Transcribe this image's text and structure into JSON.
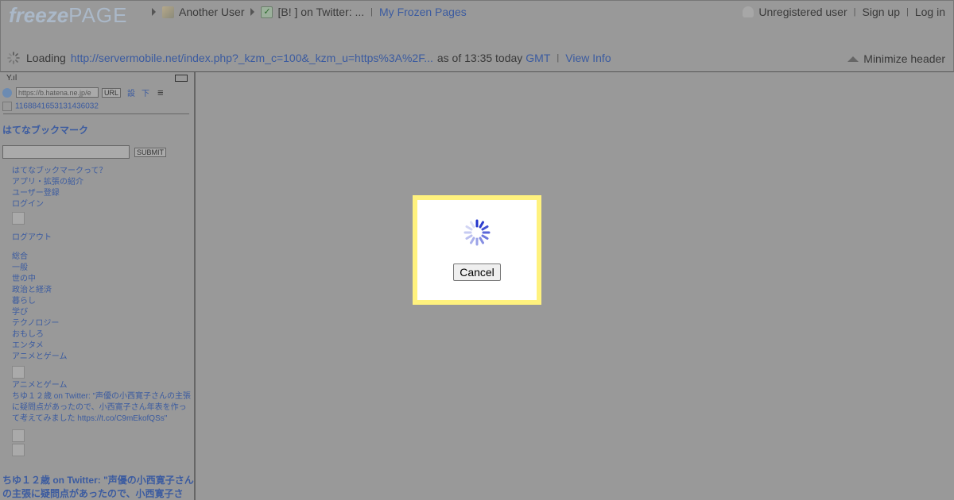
{
  "header": {
    "logo": {
      "freeze": "freeze",
      "page": "PAGE"
    },
    "breadcrumbs": [
      {
        "label": "Another User",
        "icon": "users-icon"
      },
      {
        "label": "[B! ] on Twitter: ...",
        "icon": "checkmark-icon"
      }
    ],
    "my_frozen_pages": "My Frozen Pages",
    "user_status": "Unregistered user",
    "sign_up": "Sign up",
    "log_in": "Log in",
    "loading_label": "Loading",
    "loading_url": "http://servermobile.net/index.php?_kzm_c=100&_kzm_u=https%3A%2F...",
    "as_of": "as of 13:35 today",
    "timezone": "GMT",
    "view_info": "View Info",
    "minimize_header": "Minimize header"
  },
  "mobile_page": {
    "signal": "Y.ıl",
    "url_value": "https://b.hatena.ne.jp/e",
    "url_button": "URL",
    "setting_link": "設",
    "down_link": "下",
    "menu_glyph": "≡",
    "page_id": "1168841653131436032",
    "site_title": "はてなブックマーク",
    "submit": "SUBMIT",
    "nav_links": [
      "はてなブックマークって？",
      "アプリ・拡張の紹介",
      "ユーザー登録",
      "ログイン"
    ],
    "logout": "ログアウト",
    "categories": [
      "総合",
      "一般",
      "世の中",
      "政治と経済",
      "暮らし",
      "学び",
      "テクノロジー",
      "おもしろ",
      "エンタメ",
      "アニメとゲーム"
    ],
    "category_label": "アニメとゲーム",
    "entry_text": "ちゆ１２歳 on Twitter: \"声優の小西寛子さんの主張に疑問点があったので、小西寛子さん年表を作って考えてみました https://t.co/C9mEkofQSs\"",
    "headline": "ちゆ１２歳 on Twitter: \"声優の小西寛子さんの主張に疑問点があったので、小西寛子さ"
  },
  "modal": {
    "cancel": "Cancel"
  },
  "colors": {
    "overlay": "#999999",
    "link": "#3b5ba0",
    "modal_border": "#fff27e",
    "spinner": "#2233cc"
  }
}
